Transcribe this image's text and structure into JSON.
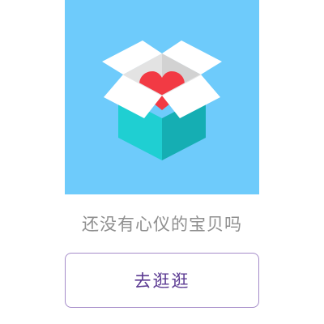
{
  "empty_state": {
    "message": "还没有心仪的宝贝吗",
    "button_label": "去逛逛",
    "illustration_icon": "open-gift-box-heart-icon"
  },
  "colors": {
    "hero_background": "#6ECBFB",
    "box_flap_white": "#FFFFFF",
    "box_front": "#1BC5C8",
    "box_side": "#15AEB3",
    "box_inner": "#D7D7D7",
    "heart": "#F23A44",
    "message_text": "#8F8F8F",
    "button_border": "#A58CC9",
    "button_text": "#5B3A92"
  }
}
